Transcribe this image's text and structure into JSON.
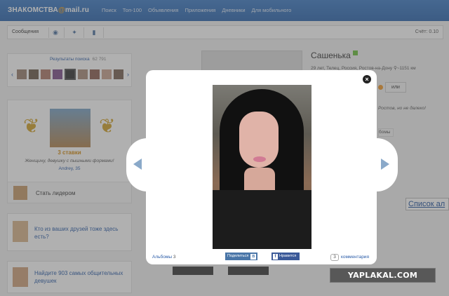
{
  "header": {
    "logo_text": "ЗНАКОМСТВА",
    "logo_at": "@",
    "logo_domain": "mail.ru",
    "nav": [
      "Поиск",
      "Топ-100",
      "Объявления",
      "Приложения",
      "Дневники",
      "Для мобильного"
    ]
  },
  "toolbar": {
    "messages": "Сообщения",
    "score": "Счёт: 0.10"
  },
  "search_results": {
    "title": "Результаты поиска",
    "count": "62 791"
  },
  "leader": {
    "stakes": "3 ставки",
    "quote": "Женщину, девушку с пышными формами!",
    "user": "Andrey, 35",
    "button": "Стать лидером"
  },
  "friends_promo": "Кто из ваших друзей тоже здесь есть?",
  "girls_promo": "Найдите 903 самых общительных девушек",
  "profile": {
    "name": "Сашенька",
    "info": "29 лет, Телец, Россия, Ростов-на-Дону",
    "distance": "~1151 км",
    "button": "или",
    "bg_text": "Ростов, но не далеко!",
    "bg_tab": "бомы",
    "list_link": "Список ал"
  },
  "viewer": {
    "albums_label": "Альбомы",
    "albums_count": "3",
    "share_label": "Поделиться",
    "share_vk": "В",
    "fb_label": "Нравится",
    "fb_icon": "f",
    "comments_count": "3",
    "comments_label": "комментария",
    "close_glyph": "×"
  },
  "watermark": "YAPLAKAL.COM",
  "colors": {
    "header": "#3e7cc6",
    "link": "#2a5ca8",
    "accent": "#f7a21a",
    "fb": "#3b5998",
    "vk": "#4a76a8"
  }
}
